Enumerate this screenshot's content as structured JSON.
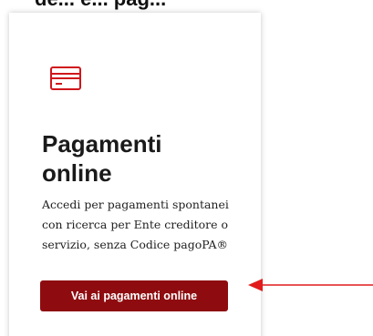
{
  "header": {
    "cut_text": "de... e... pag..."
  },
  "card": {
    "icon": "credit-card-icon",
    "title_line1": "Pagamenti",
    "title_line2": "online",
    "description": "Accedi per pagamenti spontanei con ricerca per Ente creditore o servizio, senza Codice pagoPA®",
    "button_label": "Vai ai pagamenti online"
  },
  "colors": {
    "accent": "#8e0c0f",
    "icon": "#d0161b",
    "annotation": "#e11b1b"
  }
}
